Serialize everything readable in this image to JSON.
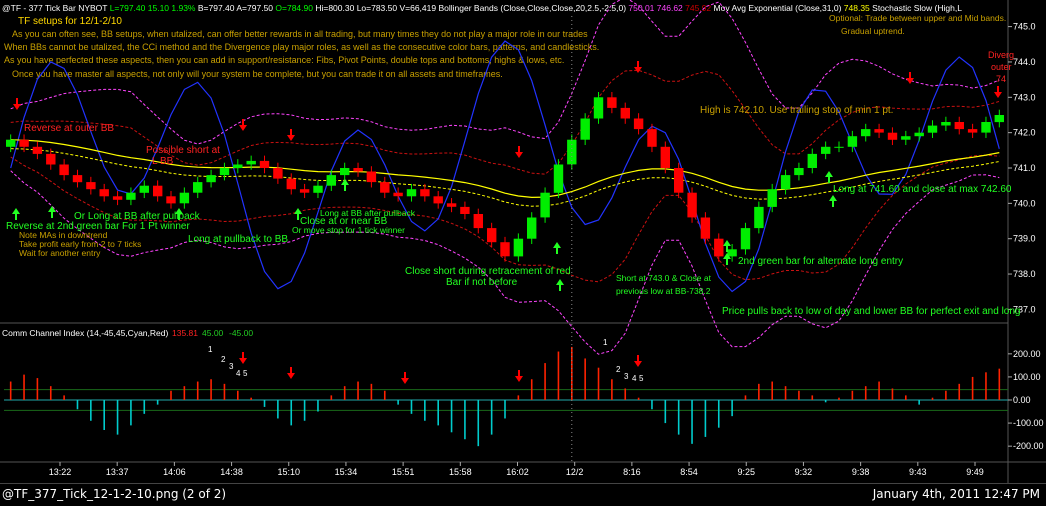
{
  "header": {
    "items": [
      {
        "text": "@TF - 377 Tick Bar",
        "color": "#ffffff"
      },
      {
        "text": "NYBOT",
        "color": "#ffffff"
      },
      {
        "text": "L=797.40",
        "color": "#00ff00"
      },
      {
        "text": "15.10",
        "color": "#00ff00"
      },
      {
        "text": "1.93%",
        "color": "#00ff00"
      },
      {
        "text": "B=797.40",
        "color": "#ffffff"
      },
      {
        "text": "A=797.50",
        "color": "#ffffff"
      },
      {
        "text": "O=784.90",
        "color": "#00ff00"
      },
      {
        "text": "Hi=800.30",
        "color": "#ffffff"
      },
      {
        "text": "Lo=783.50",
        "color": "#ffffff"
      },
      {
        "text": "V=66,419",
        "color": "#ffffff"
      },
      {
        "text": "Bollinger Bands (Close,Close,Close,20,2.5,-2.5,0)",
        "color": "#ffffff"
      },
      {
        "text": "750.01",
        "color": "#ff44ff"
      },
      {
        "text": "746.62",
        "color": "#ff44ff"
      },
      {
        "text": "745.92",
        "color": "#cc0000"
      },
      {
        "text": "Mov Avg Exponential (Close,31,0)",
        "color": "#ffffff"
      },
      {
        "text": "748.35",
        "color": "#ffff00"
      },
      {
        "text": "Stochastic Slow (High,L",
        "color": "#ffffff"
      }
    ]
  },
  "setup_title": "TF setups for 12/1-2/10",
  "commentary": [
    "As you can often see, BB setups, when utalized, can offer better rewards in all trading, but many times they do not play a major role in our trades",
    "When BBs cannot be utalized, the CCi method and the Divergence play major roles, as well as the consecutive color bars, patterns, and candlesticks.",
    "As you have perfected these aspects, then you can add in support/resistance: Fibs, Pivot Points, double tops and bottoms, highs & lows, etc.",
    "Once you have master all aspects, not only will your system be complete, but you can trade it on all assets and timeframes."
  ],
  "optional_note": [
    "Optional: Trade between upper and Mid bands.",
    "Gradual uptrend."
  ],
  "divergence_note": [
    "Diverg",
    "outer",
    "74"
  ],
  "annotations_red": [
    {
      "id": "rev-outer",
      "text": "Reverse at outer BB"
    },
    {
      "id": "poss-short-1",
      "text": "Possible short at"
    },
    {
      "id": "poss-short-2",
      "text": "L BB"
    }
  ],
  "annotations_green": [
    {
      "id": "rev-2nd-a",
      "text": "Reverse at 2nd green bar"
    },
    {
      "id": "or-long-a",
      "text": "Or Long at BB after pullback"
    },
    {
      "id": "or-long-b",
      "text": "For 1 Pt winner"
    },
    {
      "id": "long-pull",
      "text": "Long at pullback to BB"
    },
    {
      "id": "close-near",
      "text": "Close at or near BB"
    },
    {
      "id": "close-short-a",
      "text": "Close short  during retracement of red"
    },
    {
      "id": "close-short-b",
      "text": "Bar if not before"
    },
    {
      "id": "short-743-a",
      "text": "Short at 743.0 & Close at"
    },
    {
      "id": "short-743-b",
      "text": "previous low at BB-738.2"
    },
    {
      "id": "second-green",
      "text": "2nd green bar for alternate long entry"
    },
    {
      "id": "long-741",
      "text": "Long at 741.60 and close at max 742.60"
    },
    {
      "id": "pulls-back",
      "text": "Price pulls back to low of day and lower BB for perfect exit and long"
    }
  ],
  "annotations_small_green": [
    {
      "id": "long-bb-a",
      "text": "Long at BB after pullback"
    },
    {
      "id": "long-bb-b",
      "text": "Or move stop for 1 tick winner"
    }
  ],
  "annotations_olive": [
    {
      "id": "note-mas",
      "text": "Note MAs in downtrend"
    },
    {
      "id": "take-profit",
      "text": "Take profit early from 2 to 7 ticks"
    },
    {
      "id": "wait-entry",
      "text": "Wait for another entry"
    },
    {
      "id": "high-is",
      "text": "High is 742.10. Use trailing stop of min 1 pt."
    }
  ],
  "cci_header": {
    "label": "Comm Channel Index (14,-45,45,Cyan,Red)",
    "value": "135.81",
    "upper": "45.00",
    "lower": "-45.00"
  },
  "cci_counts_1": [
    "1",
    "2",
    "3",
    "4",
    "5"
  ],
  "cci_counts_2": [
    "1",
    "2",
    "3",
    "4",
    "5"
  ],
  "footer_left": "@TF_377_Tick_12-1-2-10.png (2 of 2)",
  "footer_right": "January 4th, 2011 12:47 PM",
  "colors": {
    "up": "#00ee00",
    "down": "#ff0000",
    "bb_outer": "#ff44ff",
    "bb_inner": "#cc1111",
    "ema": "#ffff00",
    "stoch": "#2233ff",
    "cci_pos": "#ff2200",
    "cci_neg": "#00cccc"
  },
  "chart_data": [
    {
      "type": "candlestick",
      "title": "@TF - 377 Tick Bar",
      "y_axis_ticks": [
        745.0,
        744.0,
        743.0,
        742.0,
        741.0,
        740.0,
        739.0,
        738.0,
        737.0
      ],
      "ylim": [
        736.7,
        745.3
      ],
      "x_tick_labels": [
        "13:22",
        "13:37",
        "14:06",
        "14:38",
        "15:10",
        "15:34",
        "15:51",
        "15:58",
        "16:02",
        "12/2",
        "8:16",
        "8:54",
        "9:25",
        "9:32",
        "9:38",
        "9:43",
        "9:49"
      ],
      "grid": false,
      "session_break_label": "12/2",
      "close_series": [
        741.8,
        741.6,
        741.4,
        741.1,
        740.8,
        740.6,
        740.4,
        740.2,
        740.1,
        740.3,
        740.5,
        740.2,
        740.0,
        740.3,
        740.6,
        740.8,
        741.0,
        741.1,
        741.2,
        741.0,
        740.7,
        740.4,
        740.3,
        740.5,
        740.8,
        741.0,
        740.9,
        740.6,
        740.3,
        740.2,
        740.4,
        740.2,
        740.0,
        739.9,
        739.7,
        739.3,
        738.9,
        738.5,
        739.0,
        739.6,
        740.3,
        741.1,
        741.8,
        742.4,
        743.0,
        742.7,
        742.4,
        742.1,
        741.6,
        741.0,
        740.3,
        739.6,
        739.0,
        738.5,
        738.7,
        739.3,
        739.9,
        740.4,
        740.8,
        741.0,
        741.4,
        741.6,
        741.6,
        741.9,
        742.1,
        742.0,
        741.8,
        741.9,
        742.0,
        742.2,
        742.3,
        742.1,
        742.0,
        742.3,
        742.5
      ]
    },
    {
      "type": "bar",
      "title": "Comm Channel Index (14,-45,45,Cyan,Red)",
      "y_axis_ticks": [
        200.0,
        100.0,
        0.0,
        -100.0,
        -200.0
      ],
      "ylim": [
        -260,
        260
      ],
      "levels": [
        45,
        -45
      ],
      "values": [
        80,
        110,
        95,
        60,
        20,
        -40,
        -90,
        -130,
        -150,
        -110,
        -60,
        -20,
        40,
        60,
        80,
        90,
        70,
        40,
        10,
        -30,
        -80,
        -110,
        -90,
        -50,
        20,
        60,
        80,
        70,
        40,
        -20,
        -60,
        -90,
        -110,
        -140,
        -170,
        -200,
        -150,
        -80,
        20,
        90,
        160,
        210,
        230,
        180,
        140,
        90,
        50,
        10,
        -40,
        -100,
        -150,
        -190,
        -160,
        -120,
        -70,
        20,
        70,
        80,
        60,
        40,
        20,
        -10,
        10,
        40,
        60,
        80,
        50,
        20,
        -20,
        10,
        40,
        70,
        100,
        120,
        135.81
      ]
    }
  ]
}
